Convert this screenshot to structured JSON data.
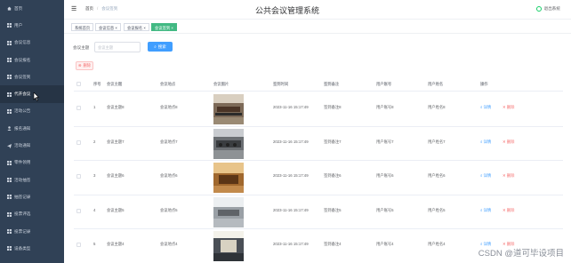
{
  "sidebar": {
    "items": [
      {
        "label": "首页",
        "icon": "home-icon"
      },
      {
        "label": "用户",
        "icon": "grid-icon"
      },
      {
        "label": "会议信息",
        "icon": "grid-icon"
      },
      {
        "label": "会议报名",
        "icon": "grid-icon"
      },
      {
        "label": "会议签到",
        "icon": "grid-icon"
      },
      {
        "label": "代开会议",
        "icon": "grid-icon"
      },
      {
        "label": "活动公告",
        "icon": "grid-icon"
      },
      {
        "label": "报名通知",
        "icon": "user-icon"
      },
      {
        "label": "活动通知",
        "icon": "send-icon"
      },
      {
        "label": "零件领用",
        "icon": "grid-icon"
      },
      {
        "label": "活动抽签",
        "icon": "grid-icon"
      },
      {
        "label": "抽签记录",
        "icon": "grid-icon"
      },
      {
        "label": "投票评选",
        "icon": "grid-icon"
      },
      {
        "label": "投票记录",
        "icon": "grid-icon"
      },
      {
        "label": "设备类型",
        "icon": "grid-icon"
      }
    ],
    "active_index": 5
  },
  "topbar": {
    "breadcrumb_home": "首页",
    "breadcrumb_current": "会议签到",
    "title": "公共会议管理系统",
    "logout": "退出系统"
  },
  "tags": [
    "系统首页",
    "会议信息 ×",
    "会议报名 ×",
    "会议签到 ×"
  ],
  "search": {
    "label": "会议主题",
    "placeholder": "会议主题",
    "button": "搜索"
  },
  "delete_button": "删除",
  "table": {
    "headers": [
      "序号",
      "会议主题",
      "会议地点",
      "会议图片",
      "签到时间",
      "签到备注",
      "用户账号",
      "用户姓名",
      "操作"
    ],
    "rows": [
      {
        "no": "1",
        "topic": "会议主题8",
        "place": "会议地点8",
        "time": "2023-11-16 15:17:49",
        "note": "签到备注8",
        "account": "用户账号8",
        "name": "用户姓名8"
      },
      {
        "no": "2",
        "topic": "会议主题7",
        "place": "会议地点7",
        "time": "2023-11-16 15:17:49",
        "note": "签到备注7",
        "account": "用户账号7",
        "name": "用户姓名7"
      },
      {
        "no": "3",
        "topic": "会议主题6",
        "place": "会议地点6",
        "time": "2023-11-16 15:17:49",
        "note": "签到备注6",
        "account": "用户账号6",
        "name": "用户姓名6"
      },
      {
        "no": "4",
        "topic": "会议主题5",
        "place": "会议地点5",
        "time": "2023-11-16 15:17:49",
        "note": "签到备注5",
        "account": "用户账号5",
        "name": "用户姓名5"
      },
      {
        "no": "5",
        "topic": "会议主题4",
        "place": "会议地点4",
        "time": "2023-11-16 15:17:49",
        "note": "签到备注4",
        "account": "用户账号4",
        "name": "用户姓名4"
      }
    ],
    "action_detail": "详情",
    "action_delete": "删除"
  },
  "watermark": "CSDN @道可毕设项目",
  "colors": {
    "sidebar_bg": "#304156",
    "primary": "#409eff",
    "danger": "#f56c6c",
    "active_tag": "#42b983"
  }
}
